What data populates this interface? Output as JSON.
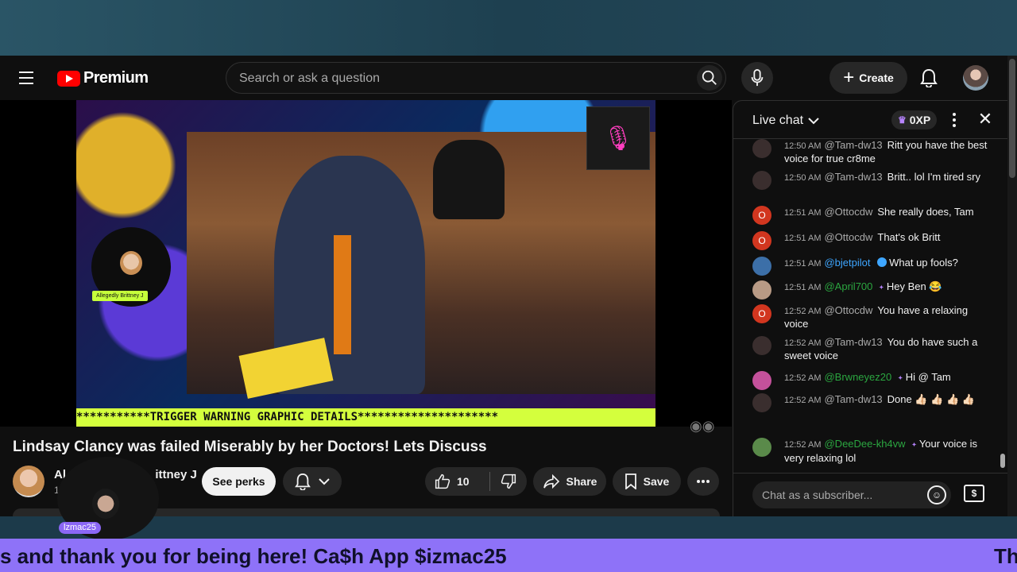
{
  "masthead": {
    "logo_text": "Premium",
    "search_placeholder": "Search or ask a question",
    "create_label": "Create"
  },
  "player": {
    "overlay_tag": "Allegedly Brittney J",
    "banner_text": "***********TRIGGER WARNING GRAPHIC DETAILS*********************"
  },
  "video": {
    "title": "Lindsay Clancy was failed Miserably by her Doctors! Lets Discuss",
    "channel_name_left": "Al",
    "channel_name_right": "ittney J",
    "subs_partial": "1",
    "perks_label": "See perks",
    "like_count": "10",
    "share_label": "Share",
    "save_label": "Save"
  },
  "chat": {
    "title": "Live chat",
    "xp_label": "0XP",
    "input_placeholder": "Chat as a subscriber...",
    "messages": [
      {
        "time": "12:50 AM",
        "author": "@Tam-dw13",
        "text": "Ritt you have the best voice for true cr8me",
        "avatar": "",
        "avatar_color": "#3a2e2e",
        "author_color": "grey"
      },
      {
        "time": "12:50 AM",
        "author": "@Tam-dw13",
        "text": "Britt.. lol I'm tired sry",
        "avatar": "",
        "avatar_color": "#3a2e2e",
        "author_color": "grey"
      },
      {
        "time": "12:51 AM",
        "author": "@Ottocdw",
        "text": "She really does, Tam",
        "avatar": "O",
        "avatar_color": "#d2361f",
        "author_color": "grey"
      },
      {
        "time": "12:51 AM",
        "author": "@Ottocdw",
        "text": "That's ok Britt",
        "avatar": "O",
        "avatar_color": "#d2361f",
        "author_color": "grey"
      },
      {
        "time": "12:51 AM",
        "author": "@bjetpilot",
        "text": "What up fools?",
        "avatar": "",
        "avatar_color": "#3c6fa8",
        "author_color": "blue"
      },
      {
        "time": "12:51 AM",
        "author": "@April700",
        "text": "Hey Ben 😂",
        "avatar": "",
        "avatar_color": "#b89a85",
        "author_color": "green"
      },
      {
        "time": "12:52 AM",
        "author": "@Ottocdw",
        "text": "You have a relaxing voice",
        "avatar": "O",
        "avatar_color": "#d2361f",
        "author_color": "grey"
      },
      {
        "time": "12:52 AM",
        "author": "@Tam-dw13",
        "text": "You do have such a sweet voice",
        "avatar": "",
        "avatar_color": "#3a2e2e",
        "author_color": "grey"
      },
      {
        "time": "12:52 AM",
        "author": "@Brwneyez20",
        "text": "Hi @ Tam",
        "avatar": "",
        "avatar_color": "#c4519b",
        "author_color": "green"
      },
      {
        "time": "12:52 AM",
        "author": "@Tam-dw13",
        "text": "Done 👍🏻 👍🏻 👍🏻 👍🏻",
        "avatar": "",
        "avatar_color": "#3a2e2e",
        "author_color": "grey"
      },
      {
        "time": "12:52 AM",
        "author": "@DeeDee-kh4vw",
        "text": "Your voice is very relaxing lol",
        "avatar": "",
        "avatar_color": "#5a8a4a",
        "author_color": "green"
      }
    ]
  },
  "overlay": {
    "cam_tag": "lzmac25",
    "ticker_main": "s and thank you for being here! Ca$h App $izmac25",
    "ticker_tail": "Th"
  },
  "colors": {
    "ticker_bg": "#8e72f8",
    "banner_bg": "#d4ff3d",
    "brand_red": "#ff0000"
  }
}
